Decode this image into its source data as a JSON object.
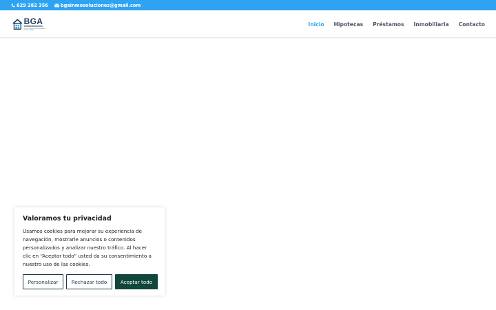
{
  "topbar": {
    "phone": "629 282 356",
    "email": "bgainmosoluciones@gmail.com"
  },
  "logo": {
    "name": "BGA",
    "subtitle": "inmosoluciones",
    "tagline": "SOLUCIONES INMOBILIARIAS Y FINANCIERAS"
  },
  "nav": {
    "items": [
      {
        "label": "Inicio",
        "active": true
      },
      {
        "label": "Hipotecas",
        "active": false
      },
      {
        "label": "Préstamos",
        "active": false
      },
      {
        "label": "Inmobiliaria",
        "active": false
      },
      {
        "label": "Contacto",
        "active": false
      }
    ]
  },
  "cookie_banner": {
    "title": "Valoramos tu privacidad",
    "text": "Usamos cookies para mejorar su experiencia de navegación, mostrarle anuncios o contenidos personalizados y analizar nuestro tráfico. Al hacer clic en “Aceptar todo” usted da su consentimiento a nuestro uso de las cookies.",
    "customize_label": "Personalizar",
    "reject_label": "Rechazar todo",
    "accept_label": "Aceptar todo"
  },
  "colors": {
    "accent": "#2ea3f2",
    "nav_text": "#4d5560",
    "brand_dark": "#1d3a5c",
    "accept_button": "#10473a"
  }
}
